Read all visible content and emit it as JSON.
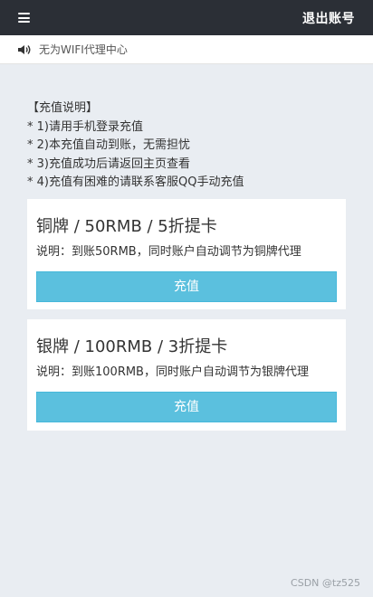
{
  "header": {
    "logout_label": "退出账号"
  },
  "notice": {
    "text": "无为WIFI代理中心"
  },
  "instructions": {
    "title": "【充值说明】",
    "lines": [
      "* 1)请用手机登录充值",
      "* 2)本充值自动到账，无需担忧",
      "* 3)充值成功后请返回主页查看",
      "* 4)充值有困难的请联系客服QQ手动充值"
    ]
  },
  "plans": [
    {
      "title": "铜牌 / 50RMB / 5折提卡",
      "description": "说明：到账50RMB，同时账户自动调节为铜牌代理",
      "button_label": "充值"
    },
    {
      "title": "银牌 / 100RMB / 3折提卡",
      "description": "说明：到账100RMB，同时账户自动调节为银牌代理",
      "button_label": "充值"
    }
  ],
  "watermark": "CSDN @tz525"
}
